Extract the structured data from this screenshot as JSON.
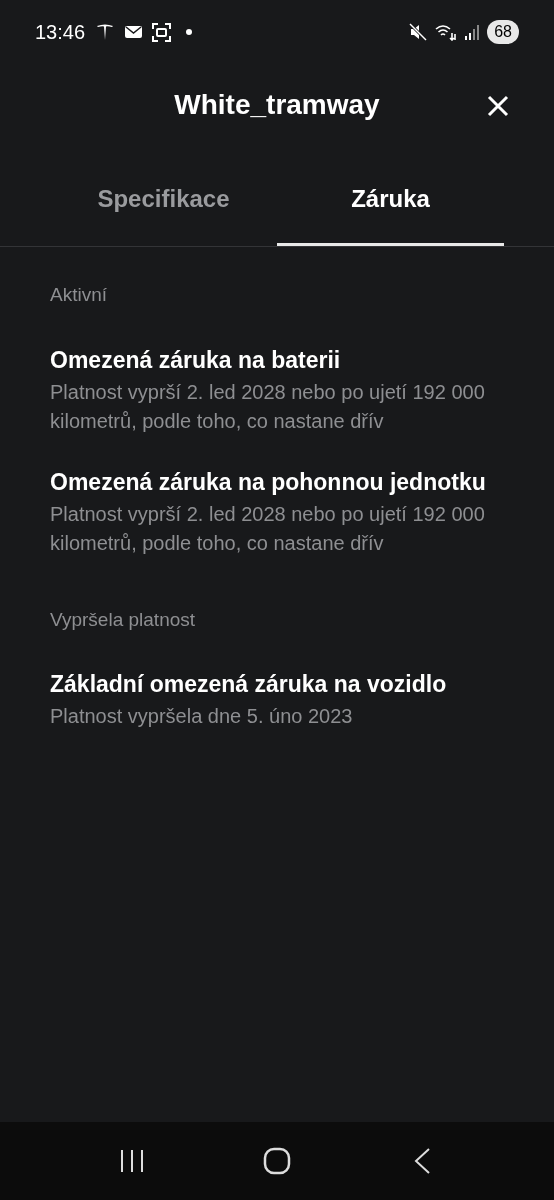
{
  "status_bar": {
    "time": "13:46",
    "battery": "68"
  },
  "header": {
    "title": "White_tramway"
  },
  "tabs": [
    {
      "label": "Specifikace",
      "selected": false
    },
    {
      "label": "Záruka",
      "selected": true
    }
  ],
  "sections": [
    {
      "heading": "Aktivní",
      "items": [
        {
          "title": "Omezená záruka na baterii",
          "detail": "Platnost vyprší 2. led 2028 nebo po ujetí 192 000 kilometrů, podle toho, co nastane dřív"
        },
        {
          "title": "Omezená záruka na pohonnou jednotku",
          "detail": "Platnost vyprší 2. led 2028 nebo po ujetí 192 000 kilometrů, podle toho, co nastane dřív"
        }
      ]
    },
    {
      "heading": "Vypršela platnost",
      "items": [
        {
          "title": "Základní omezená záruka na vozidlo",
          "detail": "Platnost vypršela dne 5. úno 2023"
        }
      ]
    }
  ]
}
